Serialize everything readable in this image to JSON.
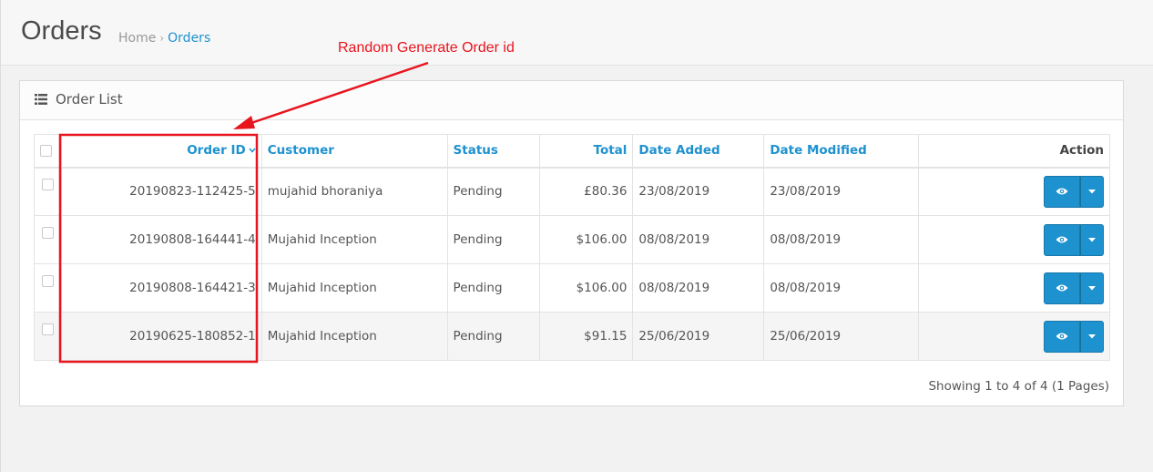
{
  "header": {
    "title": "Orders",
    "breadcrumb": {
      "home": "Home",
      "separator": "›",
      "current": "Orders"
    }
  },
  "annotation": {
    "text": "Random Generate Order id",
    "color": "#e8141e"
  },
  "panel": {
    "title": "Order List"
  },
  "table": {
    "columns": {
      "order_id": "Order ID",
      "customer": "Customer",
      "status": "Status",
      "total": "Total",
      "date_added": "Date Added",
      "date_modified": "Date Modified",
      "action": "Action"
    },
    "rows": [
      {
        "order_id": "20190823-112425-5",
        "customer": "mujahid bhoraniya",
        "status": "Pending",
        "total": "£80.36",
        "date_added": "23/08/2019",
        "date_modified": "23/08/2019"
      },
      {
        "order_id": "20190808-164441-4",
        "customer": "Mujahid Inception",
        "status": "Pending",
        "total": "$106.00",
        "date_added": "08/08/2019",
        "date_modified": "08/08/2019"
      },
      {
        "order_id": "20190808-164421-3",
        "customer": "Mujahid Inception",
        "status": "Pending",
        "total": "$106.00",
        "date_added": "08/08/2019",
        "date_modified": "08/08/2019"
      },
      {
        "order_id": "20190625-180852-1",
        "customer": "Mujahid Inception",
        "status": "Pending",
        "total": "$91.15",
        "date_added": "25/06/2019",
        "date_modified": "25/06/2019"
      }
    ]
  },
  "pagination": {
    "text": "Showing 1 to 4 of 4 (1 Pages)"
  },
  "colors": {
    "accent": "#1e91cf",
    "highlight_box": "#e8141e"
  },
  "icons": {
    "panel": "list-icon",
    "view": "eye-icon",
    "dropdown": "caret-down-icon",
    "sort": "chevron-down-icon"
  }
}
